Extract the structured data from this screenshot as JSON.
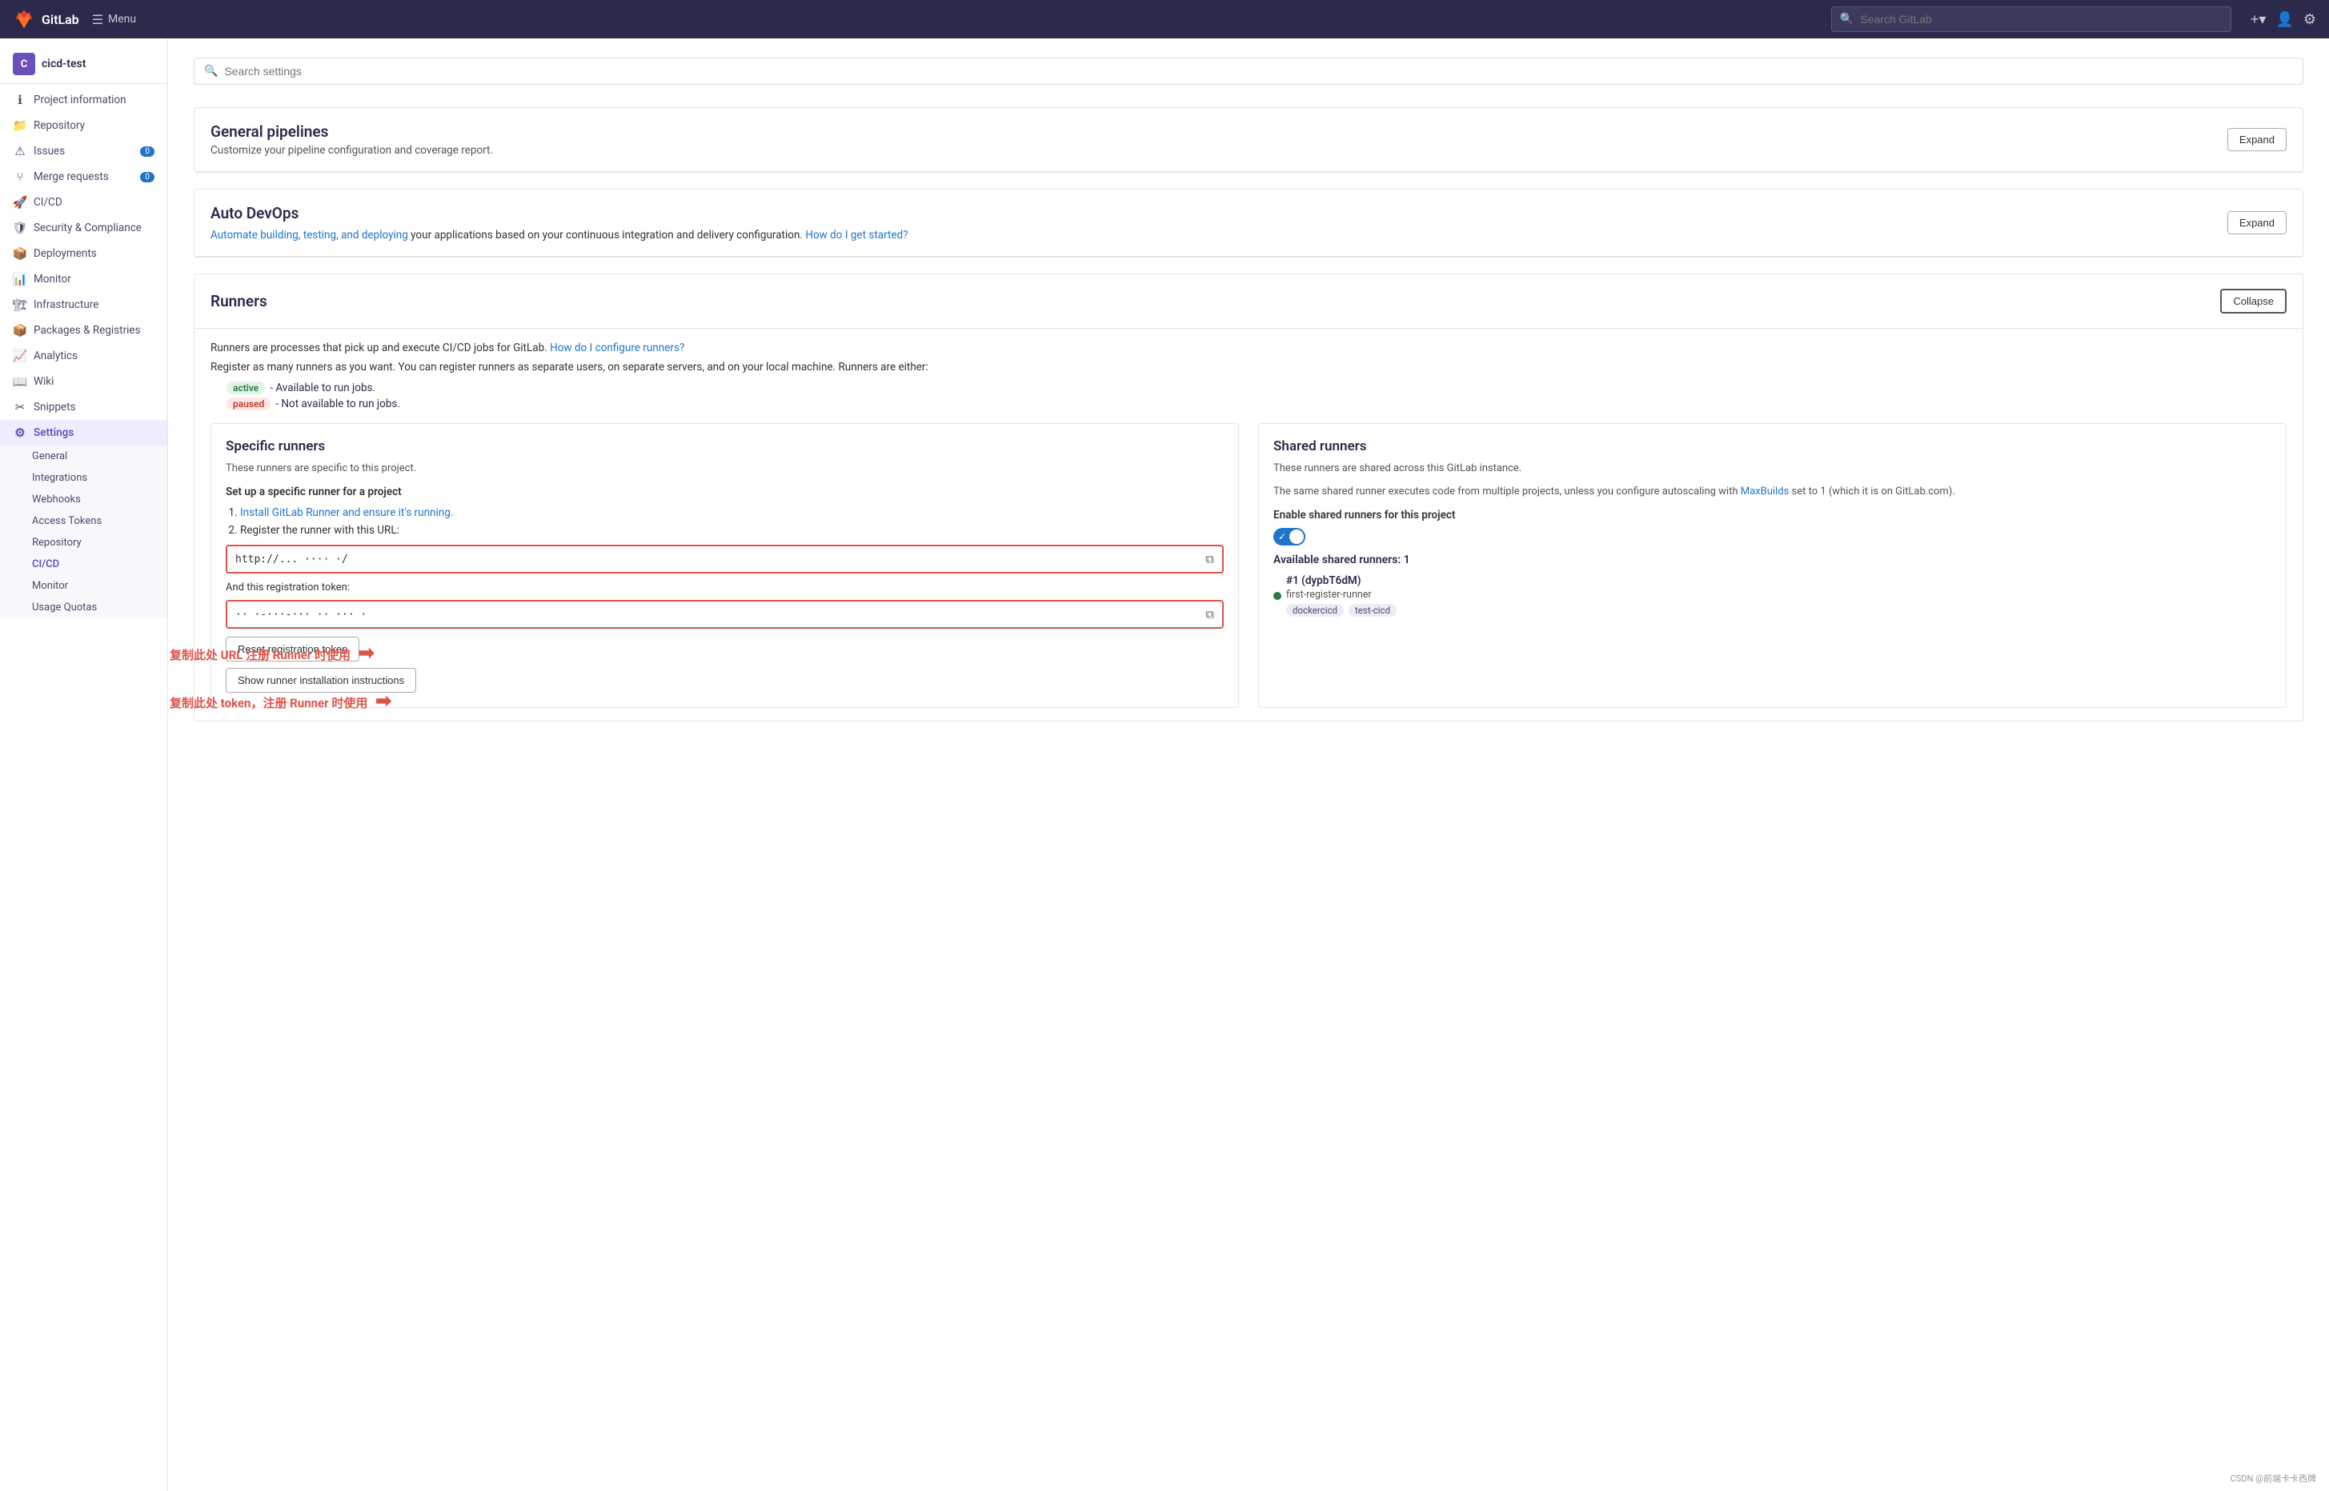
{
  "topnav": {
    "logo_text": "GitLab",
    "menu_label": "Menu",
    "search_placeholder": "Search GitLab",
    "plus_icon": "+",
    "search_icon": "🔍"
  },
  "sidebar": {
    "project_initial": "C",
    "project_name": "cicd-test",
    "items": [
      {
        "label": "Project information",
        "icon": "ℹ",
        "id": "project-information"
      },
      {
        "label": "Repository",
        "icon": "📁",
        "id": "repository"
      },
      {
        "label": "Issues",
        "icon": "⚠",
        "id": "issues",
        "badge": "0"
      },
      {
        "label": "Merge requests",
        "icon": "⑂",
        "id": "merge-requests",
        "badge": "0"
      },
      {
        "label": "CI/CD",
        "icon": "🚀",
        "id": "cicd"
      },
      {
        "label": "Security & Compliance",
        "icon": "🛡",
        "id": "security"
      },
      {
        "label": "Deployments",
        "icon": "📦",
        "id": "deployments"
      },
      {
        "label": "Monitor",
        "icon": "📊",
        "id": "monitor"
      },
      {
        "label": "Infrastructure",
        "icon": "🏗",
        "id": "infrastructure"
      },
      {
        "label": "Packages & Registries",
        "icon": "📦",
        "id": "packages"
      },
      {
        "label": "Analytics",
        "icon": "📈",
        "id": "analytics"
      },
      {
        "label": "Wiki",
        "icon": "📖",
        "id": "wiki"
      },
      {
        "label": "Snippets",
        "icon": "✂",
        "id": "snippets"
      },
      {
        "label": "Settings",
        "icon": "⚙",
        "id": "settings",
        "active": true
      }
    ],
    "settings_sub": [
      {
        "label": "General",
        "id": "settings-general"
      },
      {
        "label": "Integrations",
        "id": "settings-integrations"
      },
      {
        "label": "Webhooks",
        "id": "settings-webhooks"
      },
      {
        "label": "Access Tokens",
        "id": "settings-access-tokens"
      },
      {
        "label": "Repository",
        "id": "settings-repository"
      },
      {
        "label": "CI/CD",
        "id": "settings-cicd",
        "active": true
      },
      {
        "label": "Monitor",
        "id": "settings-monitor"
      },
      {
        "label": "Usage Quotas",
        "id": "settings-usage-quotas"
      }
    ]
  },
  "search": {
    "placeholder": "Search settings"
  },
  "sections": {
    "general_pipelines": {
      "title": "General pipelines",
      "subtitle": "Customize your pipeline configuration and coverage report.",
      "btn_label": "Expand"
    },
    "auto_devops": {
      "title": "Auto DevOps",
      "body_text": "your applications based on your continuous integration and delivery configuration.",
      "link1": "Automate building, testing, and deploying",
      "link2": "How do I get started?",
      "btn_label": "Expand"
    },
    "runners": {
      "title": "Runners",
      "btn_label": "Collapse",
      "intro": "Runners are processes that pick up and execute CI/CD jobs for GitLab.",
      "configure_link": "How do I configure runners?",
      "register_text": "Register as many runners as you want. You can register runners as separate users, on separate servers, and on your local machine. Runners are either:",
      "badge_active": "active",
      "badge_paused": "paused",
      "active_desc": "- Available to run jobs.",
      "paused_desc": "- Not available to run jobs.",
      "specific": {
        "title": "Specific runners",
        "desc": "These runners are specific to this project.",
        "setup_title": "Set up a specific runner for a project",
        "step1": "Install GitLab Runner and ensure it's running.",
        "step2": "Register the runner with this URL:",
        "url_value": "http://... ···· ·/",
        "token_label": "And this registration token:",
        "token_value": "·· ·-···-··· ·· ··· ·",
        "btn_reset": "Reset registration token",
        "btn_show": "Show runner installation instructions"
      },
      "shared": {
        "title": "Shared runners",
        "desc": "These runners are shared across this GitLab instance.",
        "desc2": "The same shared runner executes code from multiple projects, unless you configure autoscaling with",
        "maxbuilds_link": "MaxBuilds",
        "desc3": "set to 1 (which it is on GitLab.com).",
        "enable_label": "Enable shared runners for this project",
        "available_label": "Available shared runners: 1",
        "runner_id": "#1 (dypbT6dM)",
        "runner_name": "first-register-runner",
        "tag1": "dockercicd",
        "tag2": "test-cicd"
      }
    }
  },
  "annotations": {
    "text1": "复制此处 URL 注册 Runner 时使用",
    "text2": "复制此处 token，注册 Runner 时使用"
  },
  "watermark": "CSDN @前端卡卡西牌"
}
